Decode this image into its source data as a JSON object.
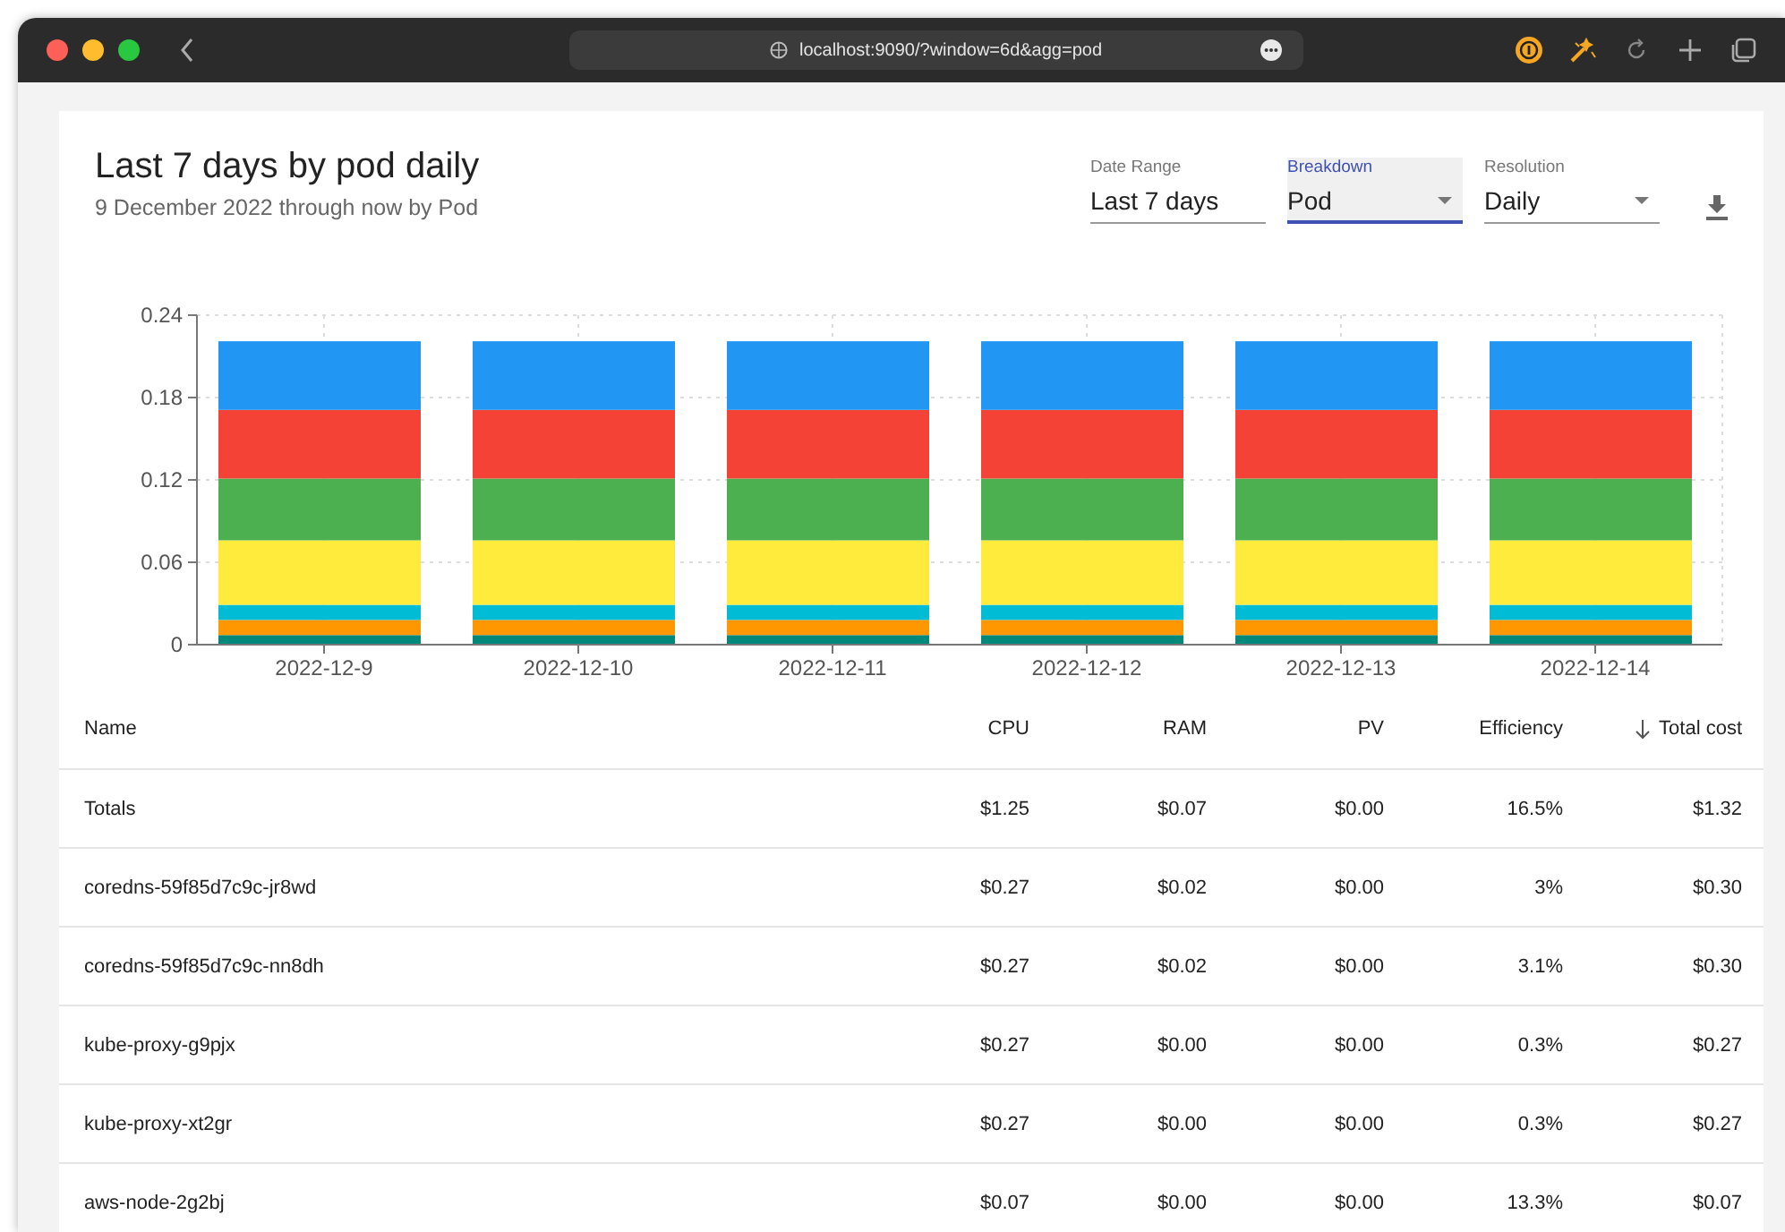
{
  "browser": {
    "url": "localhost:9090/?window=6d&agg=pod"
  },
  "report": {
    "title": "Last 7 days by pod daily",
    "subtitle": "9 December 2022 through now by Pod"
  },
  "controls": [
    {
      "label": "Date Range",
      "value": "Last 7 days",
      "kind": "text",
      "focused": false
    },
    {
      "label": "Breakdown",
      "value": "Pod",
      "kind": "select",
      "focused": true
    },
    {
      "label": "Resolution",
      "value": "Daily",
      "kind": "select",
      "focused": false
    }
  ],
  "chart": {
    "chart_data": {
      "type": "bar",
      "stacked": true,
      "grid": true,
      "categories": [
        "2022-12-9",
        "2022-12-10",
        "2022-12-11",
        "2022-12-12",
        "2022-12-13",
        "2022-12-14"
      ],
      "ylim": [
        0,
        0.24
      ],
      "yticks": [
        0,
        0.06,
        0.12,
        0.18,
        0.24
      ],
      "series": [
        {
          "color": "#00897b",
          "values": [
            0.007,
            0.007,
            0.007,
            0.007,
            0.007,
            0.007
          ]
        },
        {
          "color": "#ff9800",
          "values": [
            0.011,
            0.011,
            0.011,
            0.011,
            0.011,
            0.011
          ]
        },
        {
          "color": "#00bcd4",
          "values": [
            0.011,
            0.011,
            0.011,
            0.011,
            0.011,
            0.011
          ]
        },
        {
          "color": "#ffeb3b",
          "values": [
            0.047,
            0.047,
            0.047,
            0.047,
            0.047,
            0.047
          ]
        },
        {
          "color": "#4caf50",
          "values": [
            0.045,
            0.045,
            0.045,
            0.045,
            0.045,
            0.045
          ]
        },
        {
          "color": "#f44336",
          "values": [
            0.05,
            0.05,
            0.05,
            0.05,
            0.05,
            0.05
          ]
        },
        {
          "color": "#2196f3",
          "values": [
            0.05,
            0.05,
            0.05,
            0.05,
            0.05,
            0.05
          ]
        }
      ]
    }
  },
  "table": {
    "columns": [
      {
        "label": "Name",
        "sorted": false
      },
      {
        "label": "CPU",
        "sorted": false
      },
      {
        "label": "RAM",
        "sorted": false
      },
      {
        "label": "PV",
        "sorted": false
      },
      {
        "label": "Efficiency",
        "sorted": false
      },
      {
        "label": "Total cost",
        "sorted": true
      }
    ],
    "rows": [
      [
        "Totals",
        "$1.25",
        "$0.07",
        "$0.00",
        "16.5%",
        "$1.32"
      ],
      [
        "coredns-59f85d7c9c-jr8wd",
        "$0.27",
        "$0.02",
        "$0.00",
        "3%",
        "$0.30"
      ],
      [
        "coredns-59f85d7c9c-nn8dh",
        "$0.27",
        "$0.02",
        "$0.00",
        "3.1%",
        "$0.30"
      ],
      [
        "kube-proxy-g9pjx",
        "$0.27",
        "$0.00",
        "$0.00",
        "0.3%",
        "$0.27"
      ],
      [
        "kube-proxy-xt2gr",
        "$0.27",
        "$0.00",
        "$0.00",
        "0.3%",
        "$0.27"
      ],
      [
        "aws-node-2g2bj",
        "$0.07",
        "$0.00",
        "$0.00",
        "13.3%",
        "$0.07"
      ]
    ]
  }
}
